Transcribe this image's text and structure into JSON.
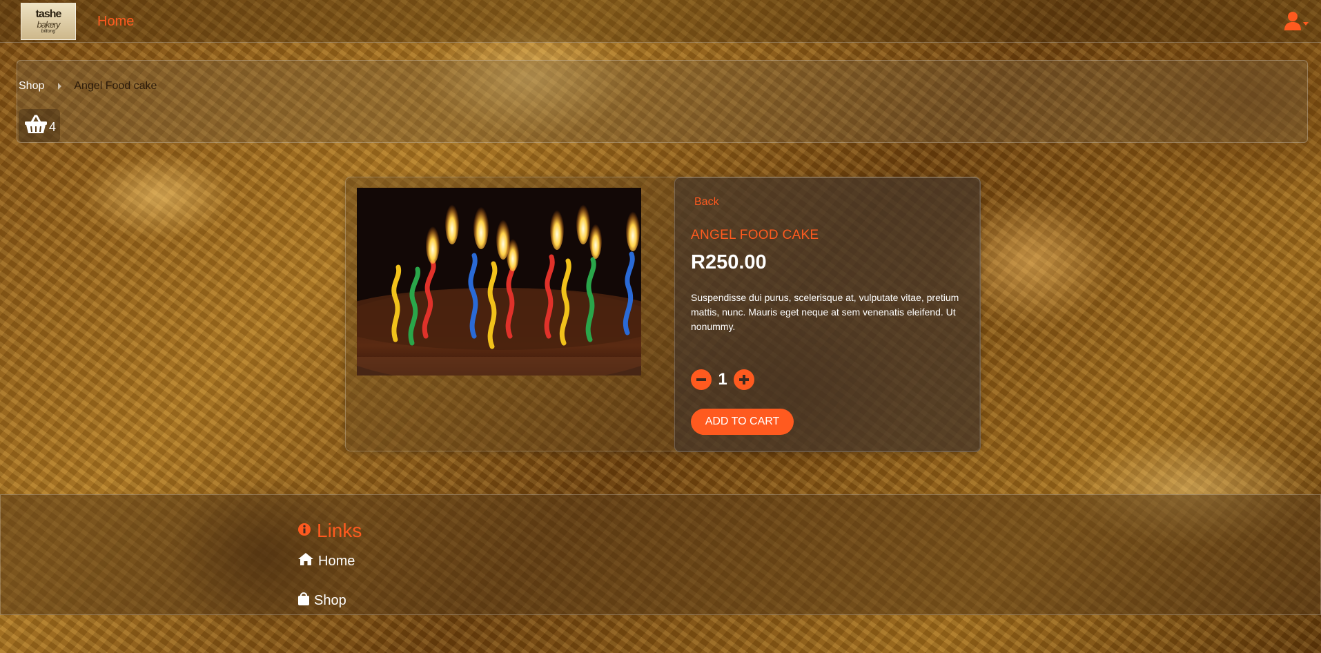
{
  "navbar": {
    "logo": {
      "line1": "tashe",
      "line2": "bakery",
      "line3": "biltong"
    },
    "home_label": "Home",
    "user_icon": "user-icon",
    "accent": "#ff5a1f"
  },
  "breadcrumb": {
    "items": [
      "Shop",
      "Angel Food cake"
    ]
  },
  "cart": {
    "icon": "basket-icon",
    "count": "4"
  },
  "product": {
    "back_label": "Back",
    "name": "ANGEL FOOD CAKE",
    "price": "R250.00",
    "description": "Suspendisse dui purus, scelerisque at, vulputate vitae, pretium mattis, nunc. Mauris eget neque at sem venenatis eleifend. Ut nonummy.",
    "quantity": "1",
    "add_to_cart_label": "ADD TO CART",
    "image_icon": "birthday-cake-candles-photo"
  },
  "footer": {
    "links_title": "Links",
    "links_icon": "info-icon",
    "links": [
      {
        "label": "Home",
        "icon": "home-icon"
      },
      {
        "label": "Shop",
        "icon": "shopping-bag-icon"
      }
    ]
  },
  "colors": {
    "accent": "#ff5a1f",
    "text": "#ffffff"
  }
}
